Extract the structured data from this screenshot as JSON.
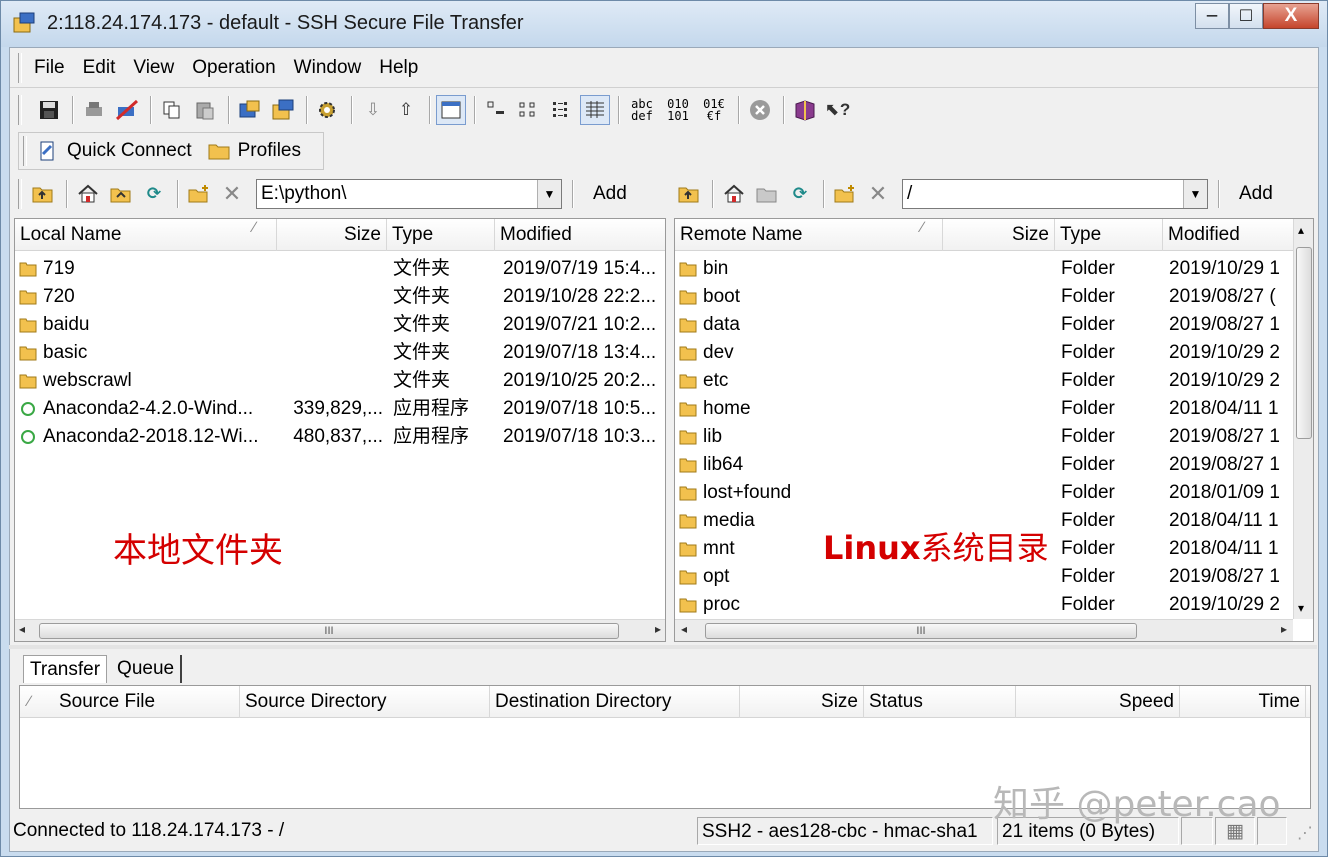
{
  "window": {
    "title": "2:118.24.174.173 - default - SSH Secure File Transfer",
    "minimize_label": "–",
    "maximize_label": "□",
    "close_label": "X"
  },
  "menu": {
    "items": [
      {
        "label": "File"
      },
      {
        "label": "Edit"
      },
      {
        "label": "View"
      },
      {
        "label": "Operation"
      },
      {
        "label": "Window"
      },
      {
        "label": "Help"
      }
    ]
  },
  "toolbar": {
    "text_buttons": [
      "abc\ndef",
      "010\n101",
      "01€\n€f"
    ]
  },
  "quick": {
    "quick_connect": "Quick Connect",
    "profiles": "Profiles"
  },
  "local": {
    "path": "E:\\python\\",
    "add_label": "Add",
    "columns": {
      "name": "Local Name",
      "size": "Size",
      "type": "Type",
      "modified": "Modified"
    },
    "rows": [
      {
        "name": "719",
        "size": "",
        "type": "文件夹",
        "modified": "2019/07/19 15:4...",
        "kind": "folder"
      },
      {
        "name": "720",
        "size": "",
        "type": "文件夹",
        "modified": "2019/10/28 22:2...",
        "kind": "folder"
      },
      {
        "name": "baidu",
        "size": "",
        "type": "文件夹",
        "modified": "2019/07/21 10:2...",
        "kind": "folder"
      },
      {
        "name": "basic",
        "size": "",
        "type": "文件夹",
        "modified": "2019/07/18 13:4...",
        "kind": "folder"
      },
      {
        "name": "webscrawl",
        "size": "",
        "type": "文件夹",
        "modified": "2019/10/25 20:2...",
        "kind": "folder"
      },
      {
        "name": "Anaconda2-4.2.0-Wind...",
        "size": "339,829,...",
        "type": "应用程序",
        "modified": "2019/07/18 10:5...",
        "kind": "app"
      },
      {
        "name": "Anaconda2-2018.12-Wi...",
        "size": "480,837,...",
        "type": "应用程序",
        "modified": "2019/07/18 10:3...",
        "kind": "app"
      }
    ],
    "overlay_label": "本地文件夹"
  },
  "remote": {
    "path": "/",
    "add_label": "Add",
    "columns": {
      "name": "Remote Name",
      "size": "Size",
      "type": "Type",
      "modified": "Modified"
    },
    "rows": [
      {
        "name": "bin",
        "type": "Folder",
        "modified": "2019/10/29 1"
      },
      {
        "name": "boot",
        "type": "Folder",
        "modified": "2019/08/27 ("
      },
      {
        "name": "data",
        "type": "Folder",
        "modified": "2019/08/27 1"
      },
      {
        "name": "dev",
        "type": "Folder",
        "modified": "2019/10/29 2"
      },
      {
        "name": "etc",
        "type": "Folder",
        "modified": "2019/10/29 2"
      },
      {
        "name": "home",
        "type": "Folder",
        "modified": "2018/04/11 1"
      },
      {
        "name": "lib",
        "type": "Folder",
        "modified": "2019/08/27 1"
      },
      {
        "name": "lib64",
        "type": "Folder",
        "modified": "2019/08/27 1"
      },
      {
        "name": "lost+found",
        "type": "Folder",
        "modified": "2018/01/09 1"
      },
      {
        "name": "media",
        "type": "Folder",
        "modified": "2018/04/11 1"
      },
      {
        "name": "mnt",
        "type": "Folder",
        "modified": "2018/04/11 1"
      },
      {
        "name": "opt",
        "type": "Folder",
        "modified": "2019/08/27 1"
      },
      {
        "name": "proc",
        "type": "Folder",
        "modified": "2019/10/29 2"
      }
    ],
    "overlay_label_latin": "Linux",
    "overlay_label_cjk": "系统目录"
  },
  "transfer": {
    "tabs": [
      "Transfer",
      "Queue"
    ],
    "columns": [
      "Source File",
      "Source Directory",
      "Destination Directory",
      "Size",
      "Status",
      "Speed",
      "Time"
    ]
  },
  "status": {
    "connection": "Connected to 118.24.174.173 - /",
    "cipher": "SSH2 - aes128-cbc - hmac-sha1",
    "items": "21 items (0 Bytes)"
  },
  "watermark": "知乎 @peter.cao",
  "colors": {
    "overlay_red": "#d40000",
    "folder_yellow": "#f2c14e",
    "app_green": "#3aa845"
  }
}
